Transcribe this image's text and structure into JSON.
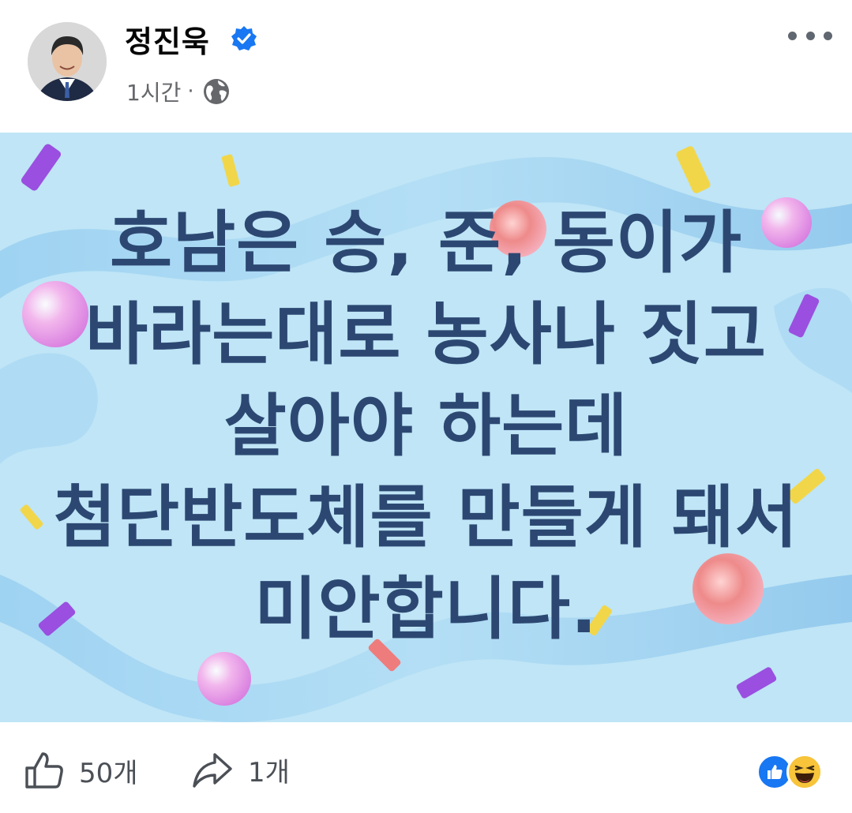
{
  "post": {
    "author": "정진욱",
    "verified": true,
    "time": "1시간",
    "separator": "·",
    "audience_icon": "globe-icon"
  },
  "image": {
    "lines": [
      "호남은 승, 준, 동이가",
      "바라는대로 농사나 짓고",
      "살아야 하는데",
      "첨단반도체를 만들게 돼서",
      "미안합니다."
    ]
  },
  "actions": {
    "like_count": "50개",
    "share_count": "1개"
  },
  "reactions": [
    "like-reaction-icon",
    "haha-reaction-icon"
  ],
  "colors": {
    "accent": "#1877f2",
    "image_bg": "#bfe5f6",
    "image_text": "#2c4872",
    "meta_text": "#65676b"
  }
}
